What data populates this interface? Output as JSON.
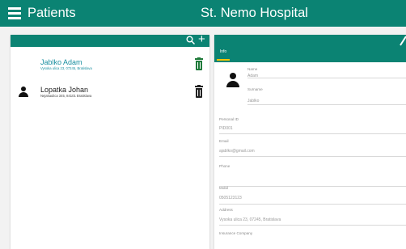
{
  "appbar": {
    "title": "Patients",
    "hospital": "St. Nemo Hospital"
  },
  "list_toolbar": {
    "search_glyph": "⚲",
    "add_glyph": "+"
  },
  "patients": [
    {
      "name": "Jablko Adam",
      "address": "Vysoka ulica 23, 07245, Bratislava",
      "selected": true
    },
    {
      "name": "Lopatka Johan",
      "address": "Nejakaulica 345, 84101 Bratislava",
      "selected": false
    }
  ],
  "detail": {
    "tab": "Info",
    "name_label": "Name",
    "name_value": "Adam",
    "surname_label": "Surname",
    "surname_value": "Jablko",
    "personal_id_label": "Personal ID",
    "personal_id_value": "PID001",
    "email_label": "Email",
    "email_value": "ajablko@gmail.com",
    "phone_label": "Phone",
    "phone_value": "",
    "mobil_label": "Mobil",
    "mobil_value": "0505123123",
    "address_label": "Address",
    "address_value": "Vysoka ulica 23, 07245, Bratislava",
    "insurance_label": "Insurance Company",
    "insurance_value": ""
  },
  "colors": {
    "primary": "#0b8373",
    "selected_text": "#1a8fa0",
    "tab_indicator": "#f5c400"
  }
}
